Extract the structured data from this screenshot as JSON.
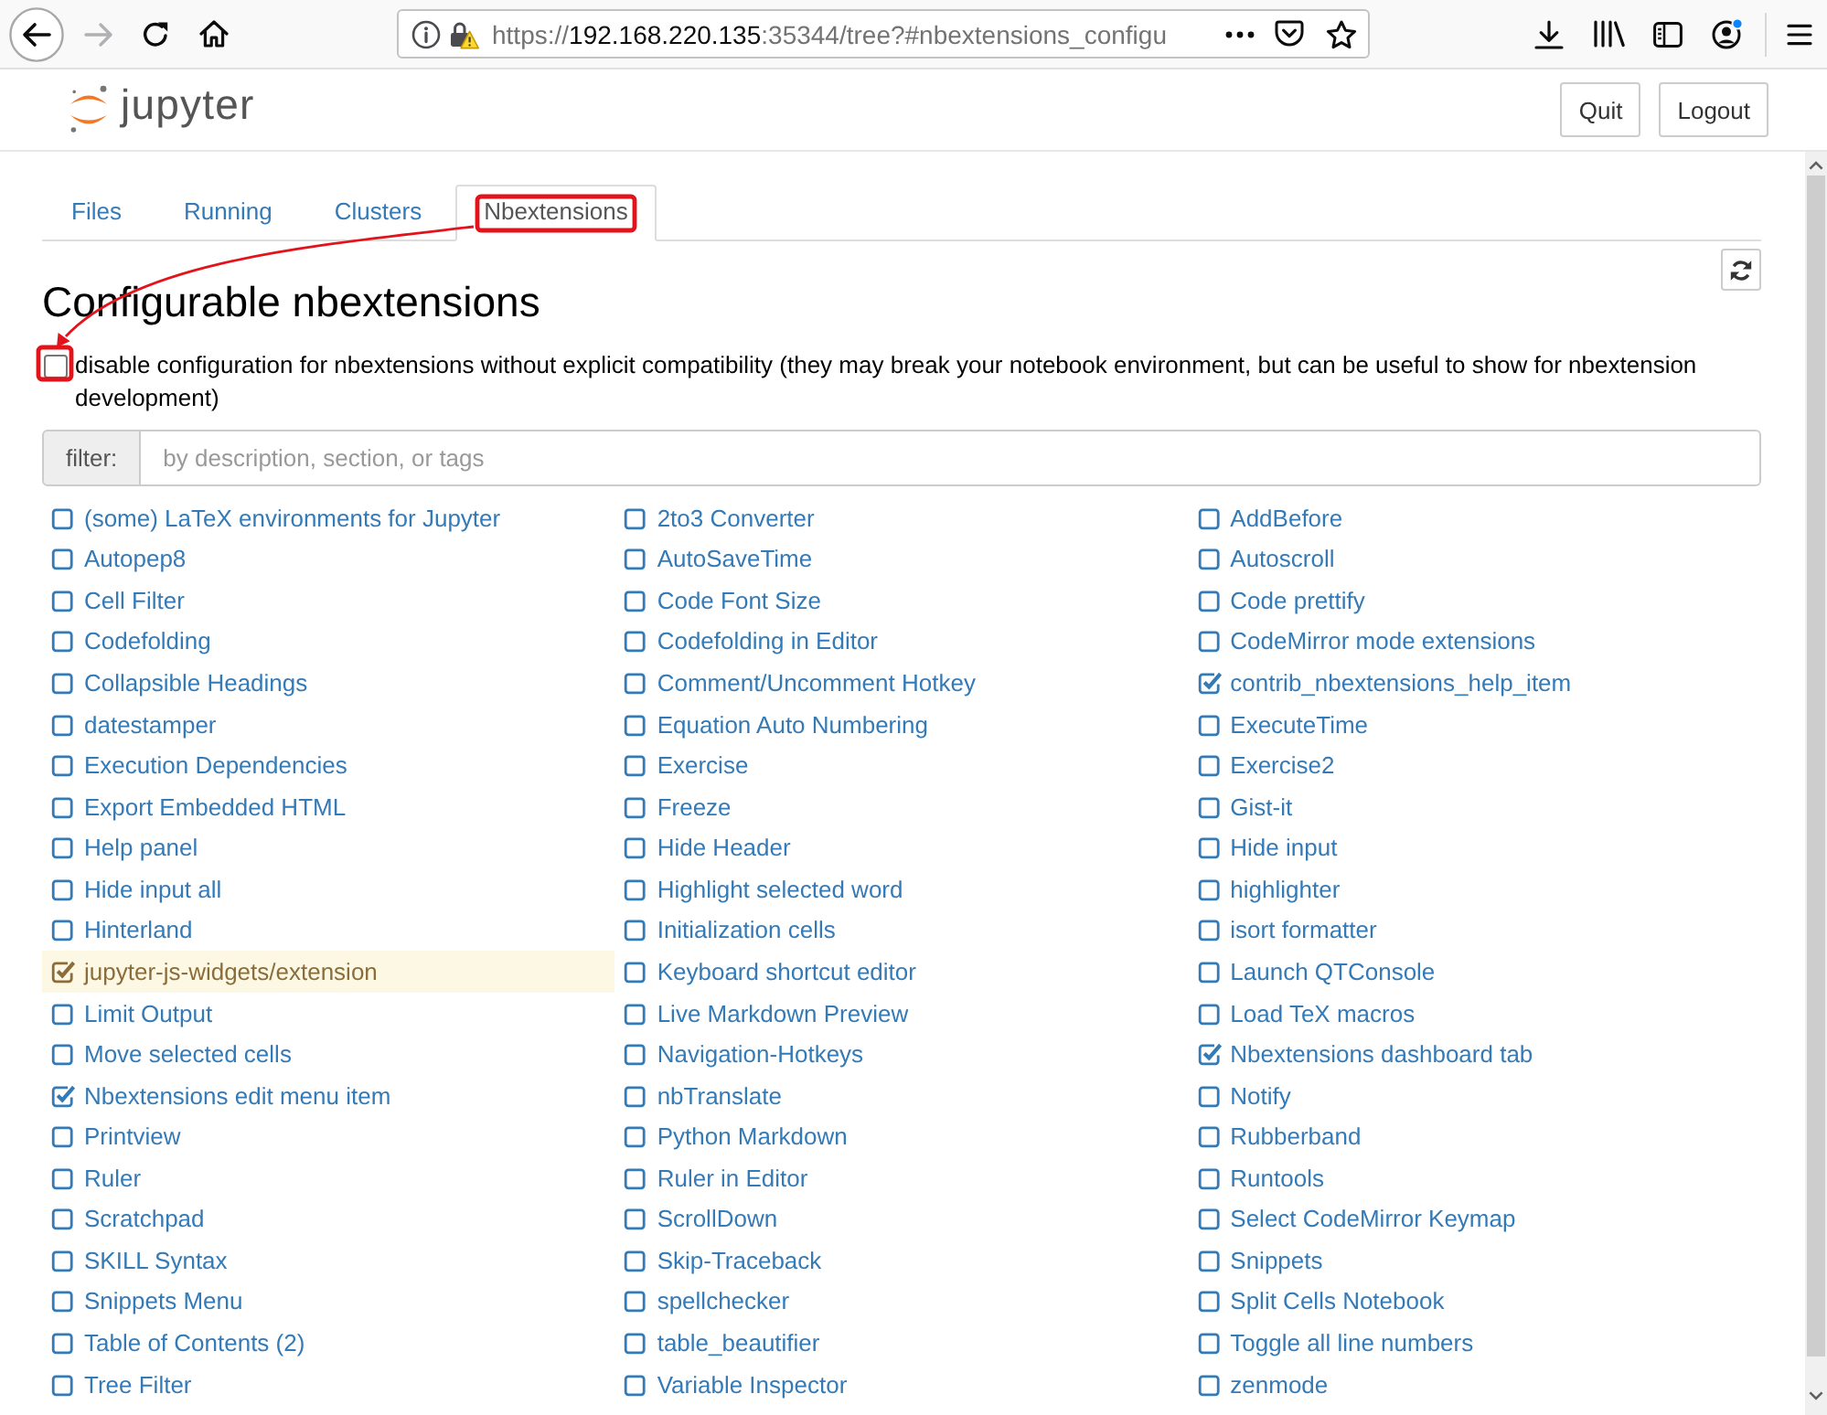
{
  "browser": {
    "forward_disabled": true,
    "url": {
      "scheme": "https://",
      "host": "192.168.220.135",
      "rest": ":35344/tree?#nbextensions_configu"
    }
  },
  "header": {
    "logo_text": "jupyter",
    "buttons": [
      "Quit",
      "Logout"
    ]
  },
  "tabs": [
    {
      "label": "Files",
      "selected": false
    },
    {
      "label": "Running",
      "selected": false
    },
    {
      "label": "Clusters",
      "selected": false
    },
    {
      "label": "Nbextensions",
      "selected": true
    }
  ],
  "heading": "Configurable nbextensions",
  "compat_option": {
    "label": "disable configuration for nbextensions without explicit compatibility (they may break your notebook environment, but can be useful to show for nbextension development)",
    "checked": false
  },
  "filter": {
    "label": "filter:",
    "placeholder": "by description, section, or tags"
  },
  "extensions": [
    {
      "label": "(some) LaTeX environments for Jupyter",
      "enabled": false,
      "highlighted": false
    },
    {
      "label": "2to3 Converter",
      "enabled": false,
      "highlighted": false
    },
    {
      "label": "AddBefore",
      "enabled": false,
      "highlighted": false
    },
    {
      "label": "Autopep8",
      "enabled": false,
      "highlighted": false
    },
    {
      "label": "AutoSaveTime",
      "enabled": false,
      "highlighted": false
    },
    {
      "label": "Autoscroll",
      "enabled": false,
      "highlighted": false
    },
    {
      "label": "Cell Filter",
      "enabled": false,
      "highlighted": false
    },
    {
      "label": "Code Font Size",
      "enabled": false,
      "highlighted": false
    },
    {
      "label": "Code prettify",
      "enabled": false,
      "highlighted": false
    },
    {
      "label": "Codefolding",
      "enabled": false,
      "highlighted": false
    },
    {
      "label": "Codefolding in Editor",
      "enabled": false,
      "highlighted": false
    },
    {
      "label": "CodeMirror mode extensions",
      "enabled": false,
      "highlighted": false
    },
    {
      "label": "Collapsible Headings",
      "enabled": false,
      "highlighted": false
    },
    {
      "label": "Comment/Uncomment Hotkey",
      "enabled": false,
      "highlighted": false
    },
    {
      "label": "contrib_nbextensions_help_item",
      "enabled": true,
      "highlighted": false
    },
    {
      "label": "datestamper",
      "enabled": false,
      "highlighted": false
    },
    {
      "label": "Equation Auto Numbering",
      "enabled": false,
      "highlighted": false
    },
    {
      "label": "ExecuteTime",
      "enabled": false,
      "highlighted": false
    },
    {
      "label": "Execution Dependencies",
      "enabled": false,
      "highlighted": false
    },
    {
      "label": "Exercise",
      "enabled": false,
      "highlighted": false
    },
    {
      "label": "Exercise2",
      "enabled": false,
      "highlighted": false
    },
    {
      "label": "Export Embedded HTML",
      "enabled": false,
      "highlighted": false
    },
    {
      "label": "Freeze",
      "enabled": false,
      "highlighted": false
    },
    {
      "label": "Gist-it",
      "enabled": false,
      "highlighted": false
    },
    {
      "label": "Help panel",
      "enabled": false,
      "highlighted": false
    },
    {
      "label": "Hide Header",
      "enabled": false,
      "highlighted": false
    },
    {
      "label": "Hide input",
      "enabled": false,
      "highlighted": false
    },
    {
      "label": "Hide input all",
      "enabled": false,
      "highlighted": false
    },
    {
      "label": "Highlight selected word",
      "enabled": false,
      "highlighted": false
    },
    {
      "label": "highlighter",
      "enabled": false,
      "highlighted": false
    },
    {
      "label": "Hinterland",
      "enabled": false,
      "highlighted": false
    },
    {
      "label": "Initialization cells",
      "enabled": false,
      "highlighted": false
    },
    {
      "label": "isort formatter",
      "enabled": false,
      "highlighted": false
    },
    {
      "label": "jupyter-js-widgets/extension",
      "enabled": true,
      "highlighted": true
    },
    {
      "label": "Keyboard shortcut editor",
      "enabled": false,
      "highlighted": false
    },
    {
      "label": "Launch QTConsole",
      "enabled": false,
      "highlighted": false
    },
    {
      "label": "Limit Output",
      "enabled": false,
      "highlighted": false
    },
    {
      "label": "Live Markdown Preview",
      "enabled": false,
      "highlighted": false
    },
    {
      "label": "Load TeX macros",
      "enabled": false,
      "highlighted": false
    },
    {
      "label": "Move selected cells",
      "enabled": false,
      "highlighted": false
    },
    {
      "label": "Navigation-Hotkeys",
      "enabled": false,
      "highlighted": false
    },
    {
      "label": "Nbextensions dashboard tab",
      "enabled": true,
      "highlighted": false
    },
    {
      "label": "Nbextensions edit menu item",
      "enabled": true,
      "highlighted": false
    },
    {
      "label": "nbTranslate",
      "enabled": false,
      "highlighted": false
    },
    {
      "label": "Notify",
      "enabled": false,
      "highlighted": false
    },
    {
      "label": "Printview",
      "enabled": false,
      "highlighted": false
    },
    {
      "label": "Python Markdown",
      "enabled": false,
      "highlighted": false
    },
    {
      "label": "Rubberband",
      "enabled": false,
      "highlighted": false
    },
    {
      "label": "Ruler",
      "enabled": false,
      "highlighted": false
    },
    {
      "label": "Ruler in Editor",
      "enabled": false,
      "highlighted": false
    },
    {
      "label": "Runtools",
      "enabled": false,
      "highlighted": false
    },
    {
      "label": "Scratchpad",
      "enabled": false,
      "highlighted": false
    },
    {
      "label": "ScrollDown",
      "enabled": false,
      "highlighted": false
    },
    {
      "label": "Select CodeMirror Keymap",
      "enabled": false,
      "highlighted": false
    },
    {
      "label": "SKILL Syntax",
      "enabled": false,
      "highlighted": false
    },
    {
      "label": "Skip-Traceback",
      "enabled": false,
      "highlighted": false
    },
    {
      "label": "Snippets",
      "enabled": false,
      "highlighted": false
    },
    {
      "label": "Snippets Menu",
      "enabled": false,
      "highlighted": false
    },
    {
      "label": "spellchecker",
      "enabled": false,
      "highlighted": false
    },
    {
      "label": "Split Cells Notebook",
      "enabled": false,
      "highlighted": false
    },
    {
      "label": "Table of Contents (2)",
      "enabled": false,
      "highlighted": false
    },
    {
      "label": "table_beautifier",
      "enabled": false,
      "highlighted": false
    },
    {
      "label": "Toggle all line numbers",
      "enabled": false,
      "highlighted": false
    },
    {
      "label": "Tree Filter",
      "enabled": false,
      "highlighted": false
    },
    {
      "label": "Variable Inspector",
      "enabled": false,
      "highlighted": false
    },
    {
      "label": "zenmode",
      "enabled": false,
      "highlighted": false
    }
  ]
}
